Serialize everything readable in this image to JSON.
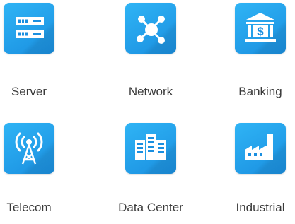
{
  "tiles": [
    {
      "label": "Server",
      "icon": "server-icon"
    },
    {
      "label": "Network",
      "icon": "network-icon"
    },
    {
      "label": "Banking",
      "icon": "bank-icon"
    },
    {
      "label": "Telecom",
      "icon": "antenna-tower-icon"
    },
    {
      "label": "Data Center",
      "icon": "data-center-icon"
    },
    {
      "label": "Industrial",
      "icon": "factory-icon"
    }
  ],
  "colors": {
    "tile_blue": "#1a8fe0",
    "tile_blue_light": "#2fb4f5",
    "label_text": "#3a3a3a"
  }
}
